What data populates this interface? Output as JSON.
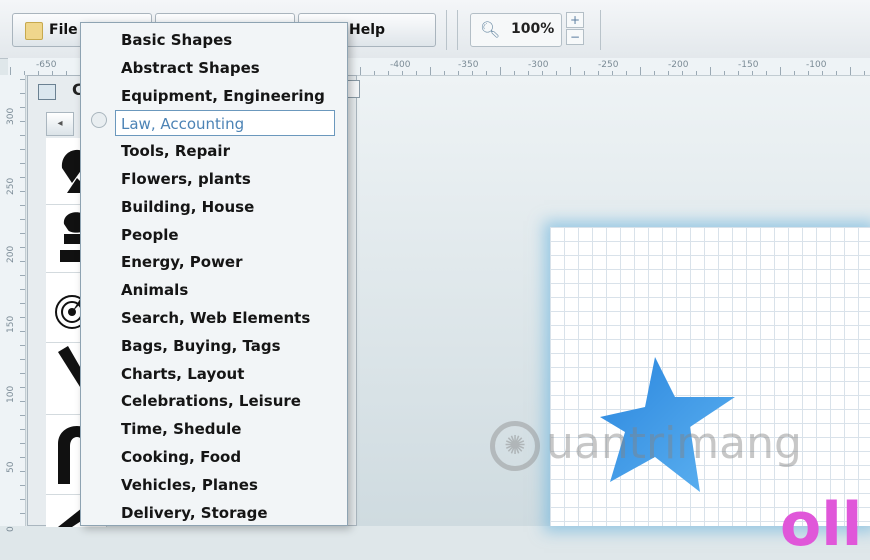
{
  "toolbar": {
    "file_label": "File",
    "help_label": "Help",
    "zoom_value": "100%",
    "zoom_plus": "+",
    "zoom_minus": "−"
  },
  "ruler": {
    "h_labels": [
      "-650",
      "-400",
      "-350",
      "-300",
      "-250",
      "-200",
      "-150",
      "-100"
    ],
    "v_labels": [
      "300",
      "250",
      "200",
      "150",
      "100",
      "50",
      "0"
    ]
  },
  "library": {
    "title_letter": "C",
    "back_arrow": "◂"
  },
  "dropdown": {
    "items": [
      "Basic Shapes",
      "Abstract Shapes",
      "Equipment, Engineering",
      "Law, Accounting",
      "Tools, Repair",
      "Flowers, plants",
      "Building, House",
      "People",
      "Energy, Power",
      "Animals",
      "Search, Web Elements",
      "Bags, Buying, Tags",
      "Charts, Layout",
      "Celebrations, Leisure",
      "Time, Shedule",
      "Cooking, Food",
      "Vehicles, Planes",
      "Delivery, Storage"
    ],
    "highlighted_index": 3
  },
  "canvas": {
    "watermark": "uantrimang",
    "pink_text": "oll"
  },
  "colors": {
    "star": "#2f8ee0",
    "page_glow": "#5fafdc",
    "pink": "#e057d9",
    "highlight": "#4c83b5"
  }
}
